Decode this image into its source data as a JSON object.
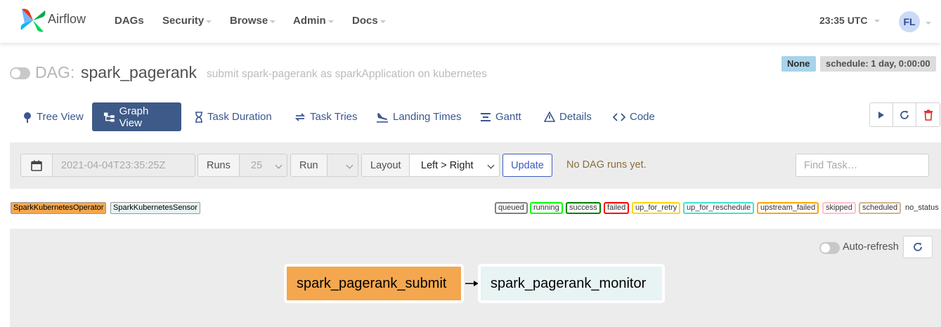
{
  "navbar": {
    "brand": "Airflow",
    "items": [
      {
        "label": "DAGs",
        "has_caret": false
      },
      {
        "label": "Security",
        "has_caret": true
      },
      {
        "label": "Browse",
        "has_caret": true
      },
      {
        "label": "Admin",
        "has_caret": true
      },
      {
        "label": "Docs",
        "has_caret": true
      }
    ],
    "time": "23:35 UTC",
    "user_initials": "FL"
  },
  "dag": {
    "prefix": "DAG:",
    "id": "spark_pagerank",
    "description": "submit spark-pagerank as sparkApplication on kubernetes",
    "badge_none": "None",
    "schedule": "schedule: 1 day, 0:00:00"
  },
  "tabs": [
    {
      "label": "Tree View",
      "icon": "tree-icon",
      "active": false
    },
    {
      "label": "Graph View",
      "icon": "graph-icon",
      "active": true
    },
    {
      "label": "Task Duration",
      "icon": "hourglass-icon",
      "active": false
    },
    {
      "label": "Task Tries",
      "icon": "retry-icon",
      "active": false
    },
    {
      "label": "Landing Times",
      "icon": "plane-landing-icon",
      "active": false
    },
    {
      "label": "Gantt",
      "icon": "gantt-icon",
      "active": false
    },
    {
      "label": "Details",
      "icon": "warning-triangle-icon",
      "active": false
    },
    {
      "label": "Code",
      "icon": "code-icon",
      "active": false
    }
  ],
  "actions": {
    "trigger": "play-icon",
    "refresh": "refresh-icon",
    "delete": "trash-icon"
  },
  "filter": {
    "date_placeholder": "2021-04-04T23:35:25Z",
    "runs_label": "Runs",
    "runs_value": "25",
    "run_label": "Run",
    "run_value": "",
    "layout_label": "Layout",
    "layout_value": "Left > Right",
    "update_label": "Update",
    "message": "No DAG runs yet.",
    "find_task_placeholder": "Find Task…"
  },
  "operators": [
    {
      "label": "SparkKubernetesOperator",
      "color": "#f4a74e"
    },
    {
      "label": "SparkKubernetesSensor",
      "color": "#e8f3f3"
    }
  ],
  "statuses": [
    {
      "label": "queued",
      "color": "#808080"
    },
    {
      "label": "running",
      "color": "#00ff00"
    },
    {
      "label": "success",
      "color": "#008000"
    },
    {
      "label": "failed",
      "color": "#ff0000"
    },
    {
      "label": "up_for_retry",
      "color": "#ffd700"
    },
    {
      "label": "up_for_reschedule",
      "color": "#40e0d0"
    },
    {
      "label": "upstream_failed",
      "color": "#ffa500"
    },
    {
      "label": "skipped",
      "color": "#ffc0cb"
    },
    {
      "label": "scheduled",
      "color": "#d2b48c"
    }
  ],
  "no_status": "no_status",
  "graph": {
    "auto_refresh_label": "Auto-refresh",
    "nodes": [
      {
        "label": "spark_pagerank_submit",
        "color": "#f4a74e"
      },
      {
        "label": "spark_pagerank_monitor",
        "color": "#e8f3f3"
      }
    ]
  }
}
